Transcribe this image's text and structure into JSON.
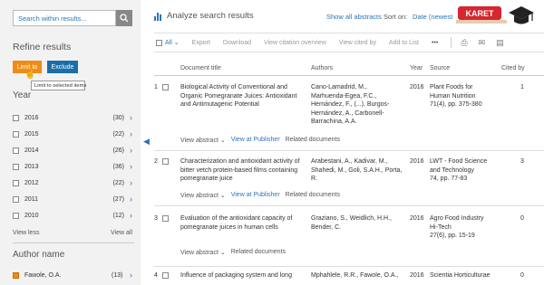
{
  "sidebar": {
    "search_placeholder": "Search within results...",
    "refine_title": "Refine results",
    "limit_label": "Limit to",
    "exclude_label": "Exclude",
    "tooltip": "Limit to selected items",
    "year_title": "Year",
    "years": [
      {
        "year": "2016",
        "count": "(30)"
      },
      {
        "year": "2015",
        "count": "(22)"
      },
      {
        "year": "2014",
        "count": "(26)"
      },
      {
        "year": "2013",
        "count": "(36)"
      },
      {
        "year": "2012",
        "count": "(22)"
      },
      {
        "year": "2011",
        "count": "(27)"
      },
      {
        "year": "2010",
        "count": "(12)"
      }
    ],
    "view_less": "View less",
    "view_all": "View all",
    "author_title": "Author name",
    "author": {
      "name": "Fawole, O.A.",
      "count": "(13)"
    }
  },
  "main": {
    "analyze_label": "Analyze search results",
    "show_all_abstracts": "Show all abstracts",
    "sort_on_label": "Sort on:",
    "sort_value": "Date (newest",
    "logo_text": "KARET",
    "toolbar": {
      "all": "All",
      "export": "Export",
      "download": "Download",
      "citation_overview": "View citation overview",
      "cited_by": "View cited by",
      "add_to_list": "Add to List",
      "more": "•••"
    },
    "columns": {
      "title": "Document title",
      "authors": "Authors",
      "year": "Year",
      "source": "Source",
      "cited": "Cited by"
    },
    "rows": [
      {
        "num": "1",
        "title": [
          "Biological Activity of Conventional and",
          "Organic Pomegranate Juices: Antioxidant",
          "and Antimutagenic Potential"
        ],
        "authors": [
          "Cano-Lamadrid, M.,",
          "Marhuenda-Egea, F.C.,",
          "Hernández, F., (...), Burgos-",
          "Hernández, A., Carbonell-",
          "Barrachina, A.A."
        ],
        "year": "2016",
        "source": [
          "Plant Foods for",
          "Human Nutrition",
          "71(4), pp. 375-380"
        ],
        "cited": "1",
        "view_abstract": "View abstract",
        "view_publisher": "View at Publisher",
        "related": "Related documents"
      },
      {
        "num": "2",
        "title": [
          "Characterization and antioxidant activity of",
          "bitter vetch protein-based films containing",
          "pomegranate juice"
        ],
        "authors": [
          "Arabestani, A., Kadivar, M.,",
          "Shahedi, M., Goli, S.A.H., Porta,",
          "R."
        ],
        "year": "2016",
        "source": [
          "LWT - Food Science",
          "and Technology",
          "74, pp. 77-83"
        ],
        "cited": "3",
        "view_abstract": "View abstract",
        "view_publisher": "View at Publisher",
        "related": "Related documents"
      },
      {
        "num": "3",
        "title": [
          "Evaluation of the antioxidant capacity of",
          "pomegranate juices in human cells"
        ],
        "authors": [
          "Graziano, S., Weidlich, H.H.,",
          "Bender, C."
        ],
        "year": "2016",
        "source": [
          "Agro Food Industry",
          "Hi-Tech",
          "27(6), pp. 15-19"
        ],
        "cited": "0",
        "view_abstract": "View abstract",
        "related": "Related documents"
      },
      {
        "num": "4",
        "title": [
          "Influence of packaging system and long"
        ],
        "authors": [
          "Mphahlele, R.R., Fawole, O.A.,"
        ],
        "year": "2016",
        "source": [
          "Scientia Horticulturae"
        ],
        "cited": "0"
      }
    ]
  }
}
